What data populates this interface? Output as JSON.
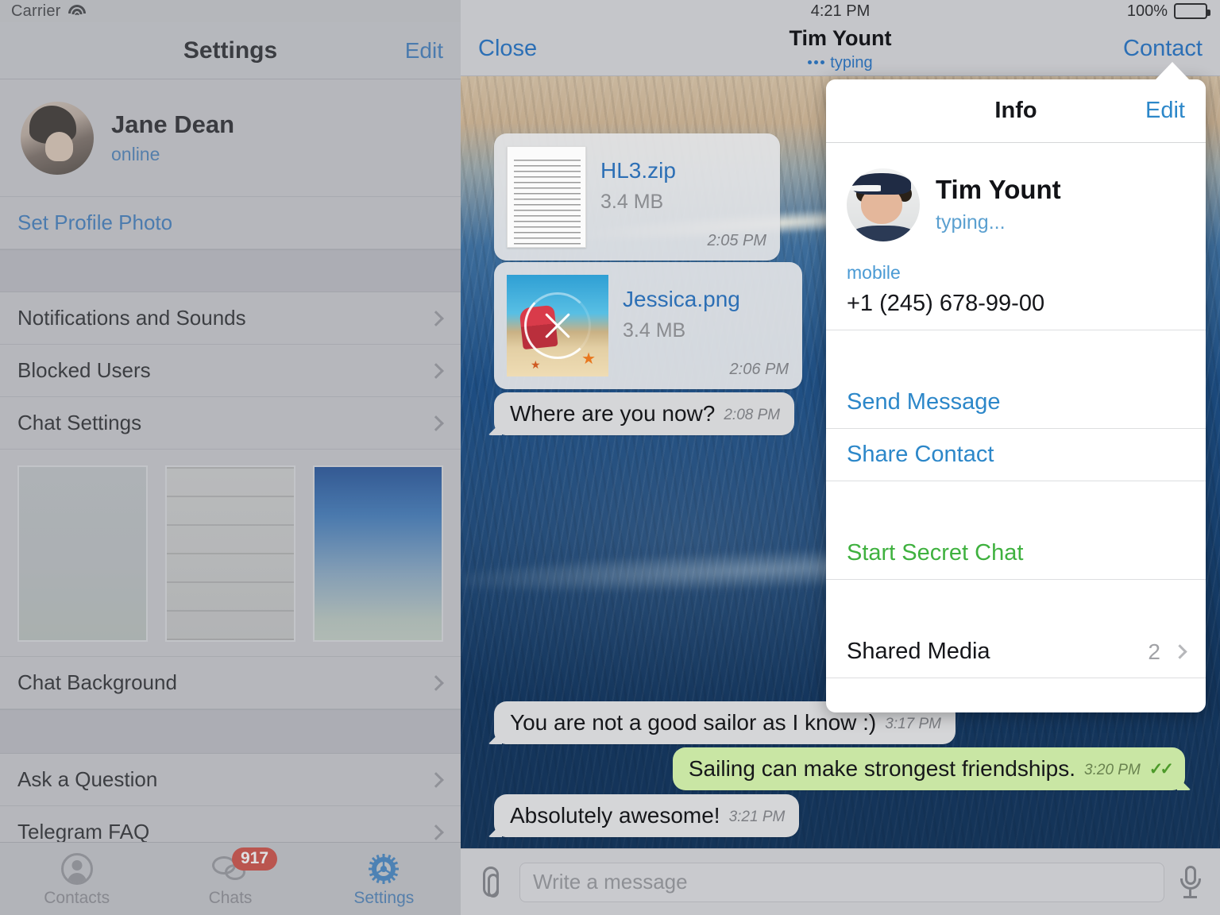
{
  "sidebar": {
    "status_bar": {
      "carrier": "Carrier",
      "wifi_icon": "wifi-icon"
    },
    "nav": {
      "title": "Settings",
      "edit_label": "Edit"
    },
    "profile": {
      "name": "Jane Dean",
      "status": "online",
      "avatar": "user-avatar"
    },
    "set_profile_photo_label": "Set Profile Photo",
    "rows": [
      {
        "label": "Notifications and Sounds"
      },
      {
        "label": "Blocked Users"
      },
      {
        "label": "Chat Settings"
      }
    ],
    "wallpapers": [
      {
        "name": "plain-gray-wallpaper"
      },
      {
        "name": "white-wood-wallpaper"
      },
      {
        "name": "blue-gradient-wallpaper"
      }
    ],
    "chat_background_label": "Chat Background",
    "support_rows": [
      {
        "label": "Ask a Question"
      },
      {
        "label": "Telegram FAQ"
      }
    ],
    "tabs": [
      {
        "label": "Contacts",
        "icon": "contacts-icon",
        "badge": "",
        "active": false
      },
      {
        "label": "Chats",
        "icon": "chats-icon",
        "badge": "917",
        "active": false
      },
      {
        "label": "Settings",
        "icon": "gear-icon",
        "badge": "",
        "active": true
      }
    ]
  },
  "chat": {
    "status_bar": {
      "time": "4:21 PM",
      "battery_percent": "100%"
    },
    "nav": {
      "close_label": "Close",
      "title": "Tim Yount",
      "subtitle": "typing",
      "contact_label": "Contact"
    },
    "messages": [
      {
        "kind": "file",
        "name": "HL3.zip",
        "size": "3.4 MB",
        "time": "2:05 PM",
        "thumb": "document-thumbnail",
        "direction": "in"
      },
      {
        "kind": "file",
        "name": "Jessica.png",
        "size": "3.4 MB",
        "time": "2:06 PM",
        "thumb": "image-thumbnail",
        "state": "downloading",
        "direction": "in"
      },
      {
        "kind": "text",
        "text": "Where are you now?",
        "time": "2:08 PM",
        "direction": "in"
      },
      {
        "kind": "text",
        "text": "You are not a good sailor as I know :)",
        "time": "3:17 PM",
        "direction": "in"
      },
      {
        "kind": "text",
        "text": "Sailing can make strongest friendships.",
        "time": "3:20 PM",
        "direction": "out",
        "ticks": "✓✓"
      },
      {
        "kind": "text",
        "text": "Absolutely awesome!",
        "time": "3:21 PM",
        "direction": "in"
      }
    ],
    "input": {
      "placeholder": "Write a message",
      "value": "",
      "attach_icon": "paperclip-icon",
      "mic_icon": "microphone-icon"
    }
  },
  "popover": {
    "header": {
      "title": "Info",
      "edit_label": "Edit"
    },
    "contact": {
      "name": "Tim Yount",
      "status": "typing...",
      "avatar": "contact-avatar"
    },
    "phone": {
      "label": "mobile",
      "value": "+1 (245) 678-99-00"
    },
    "actions": [
      {
        "label": "Send Message",
        "color": "blue"
      },
      {
        "label": "Share Contact",
        "color": "blue"
      },
      {
        "label": "Start Secret Chat",
        "color": "green"
      }
    ],
    "shared_media": {
      "label": "Shared Media",
      "count": "2"
    }
  },
  "colors": {
    "accent_blue": "#2c6fb5",
    "popover_blue": "#2c87c9",
    "secret_green": "#3fb13f",
    "badge_red": "#cb382d",
    "outgoing_bubble": "#c9e6a4",
    "incoming_bubble": "#d5d6d8"
  }
}
